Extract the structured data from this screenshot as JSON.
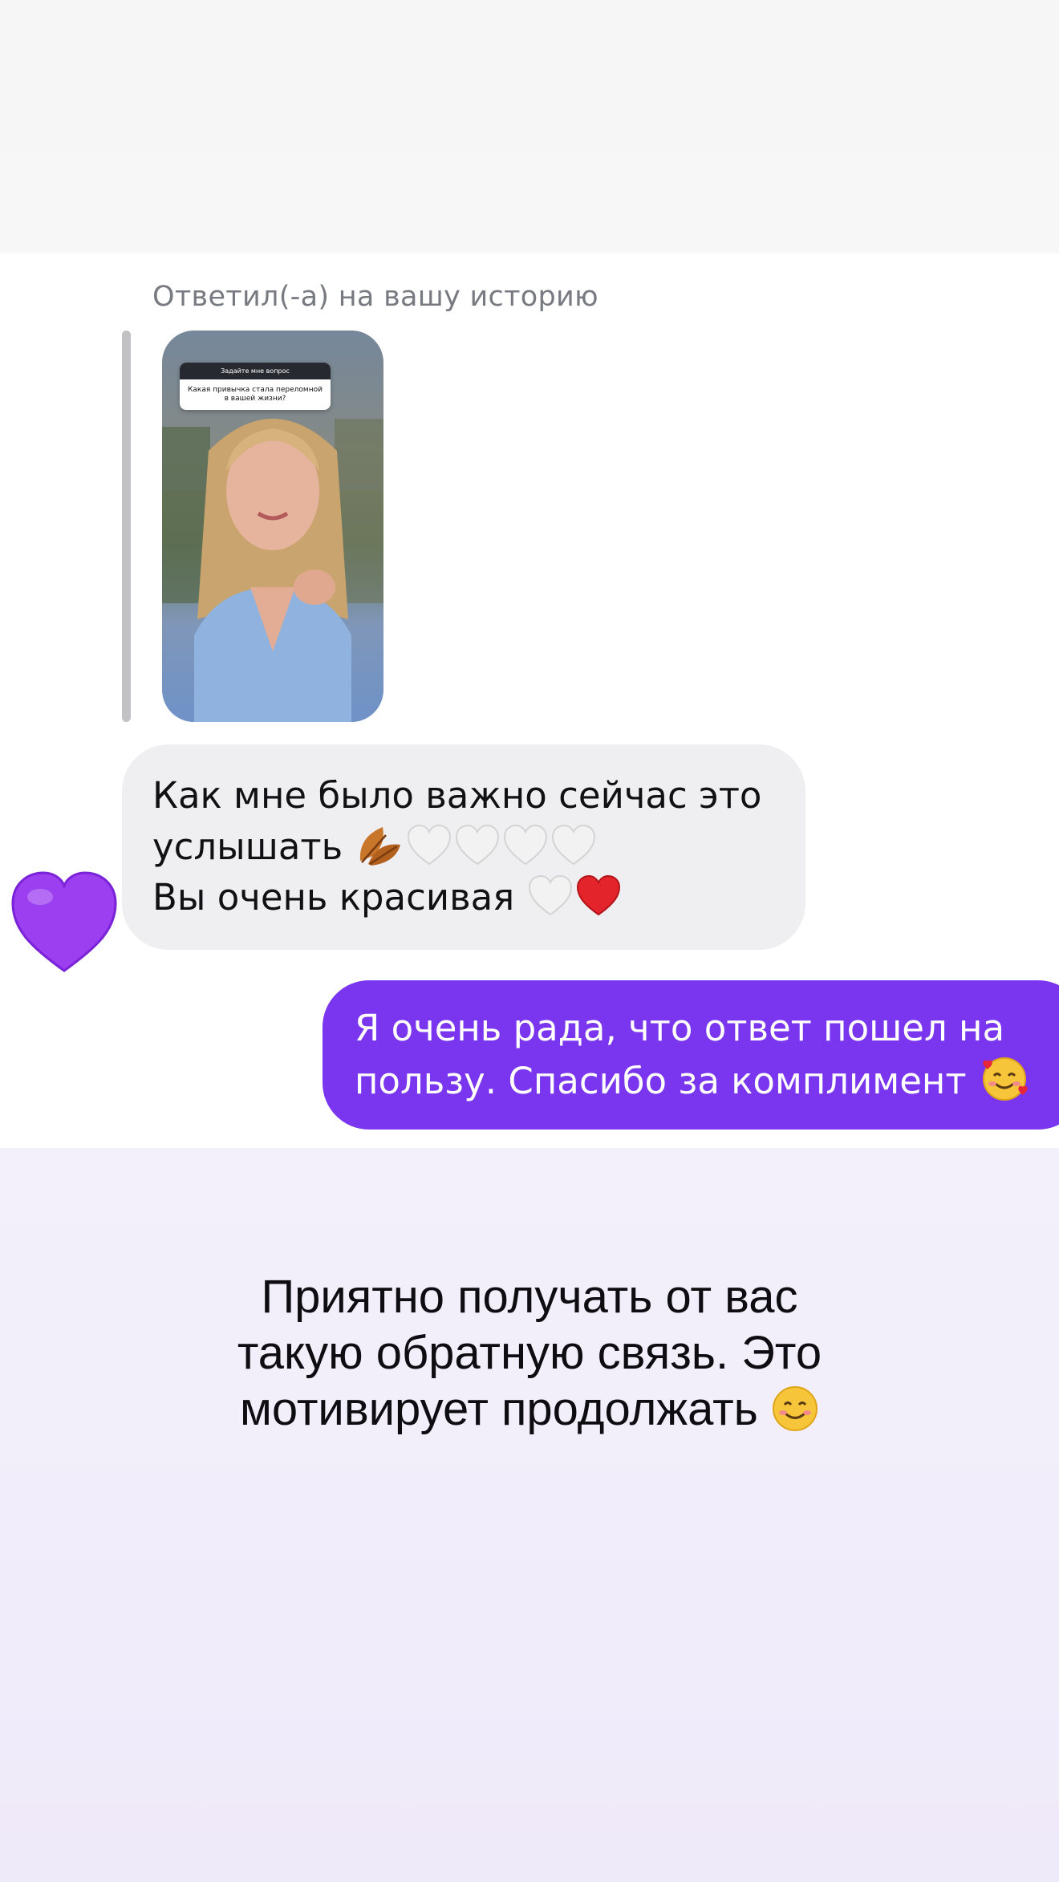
{
  "reply": {
    "caption": "Ответил(-а) на вашу историю",
    "story": {
      "question_header": "Задайте мне вопрос",
      "question_text": "Какая привычка стала переломной в вашей жизни?"
    }
  },
  "incoming": {
    "line1": "Как мне было важно сейчас это",
    "line2": "услышать",
    "line3": "Вы очень красивая",
    "icons": [
      "fallen-leaf-icon",
      "white-heart-icon",
      "white-heart-icon",
      "white-heart-icon",
      "white-heart-icon",
      "white-heart-icon",
      "red-heart-icon"
    ],
    "reaction": "purple-heart-icon"
  },
  "outgoing": {
    "line1": "Я очень рада, что ответ пошел на",
    "line2": "пользу. Спасибо за комплимент",
    "icon": "smiling-face-with-hearts-icon",
    "bubble_color": "#7a35ef"
  },
  "caption": {
    "line1": "Приятно получать от вас",
    "line2": "такую обратную связь. Это",
    "line3": "мотивирует продолжать",
    "icon": "smiling-face-icon"
  }
}
